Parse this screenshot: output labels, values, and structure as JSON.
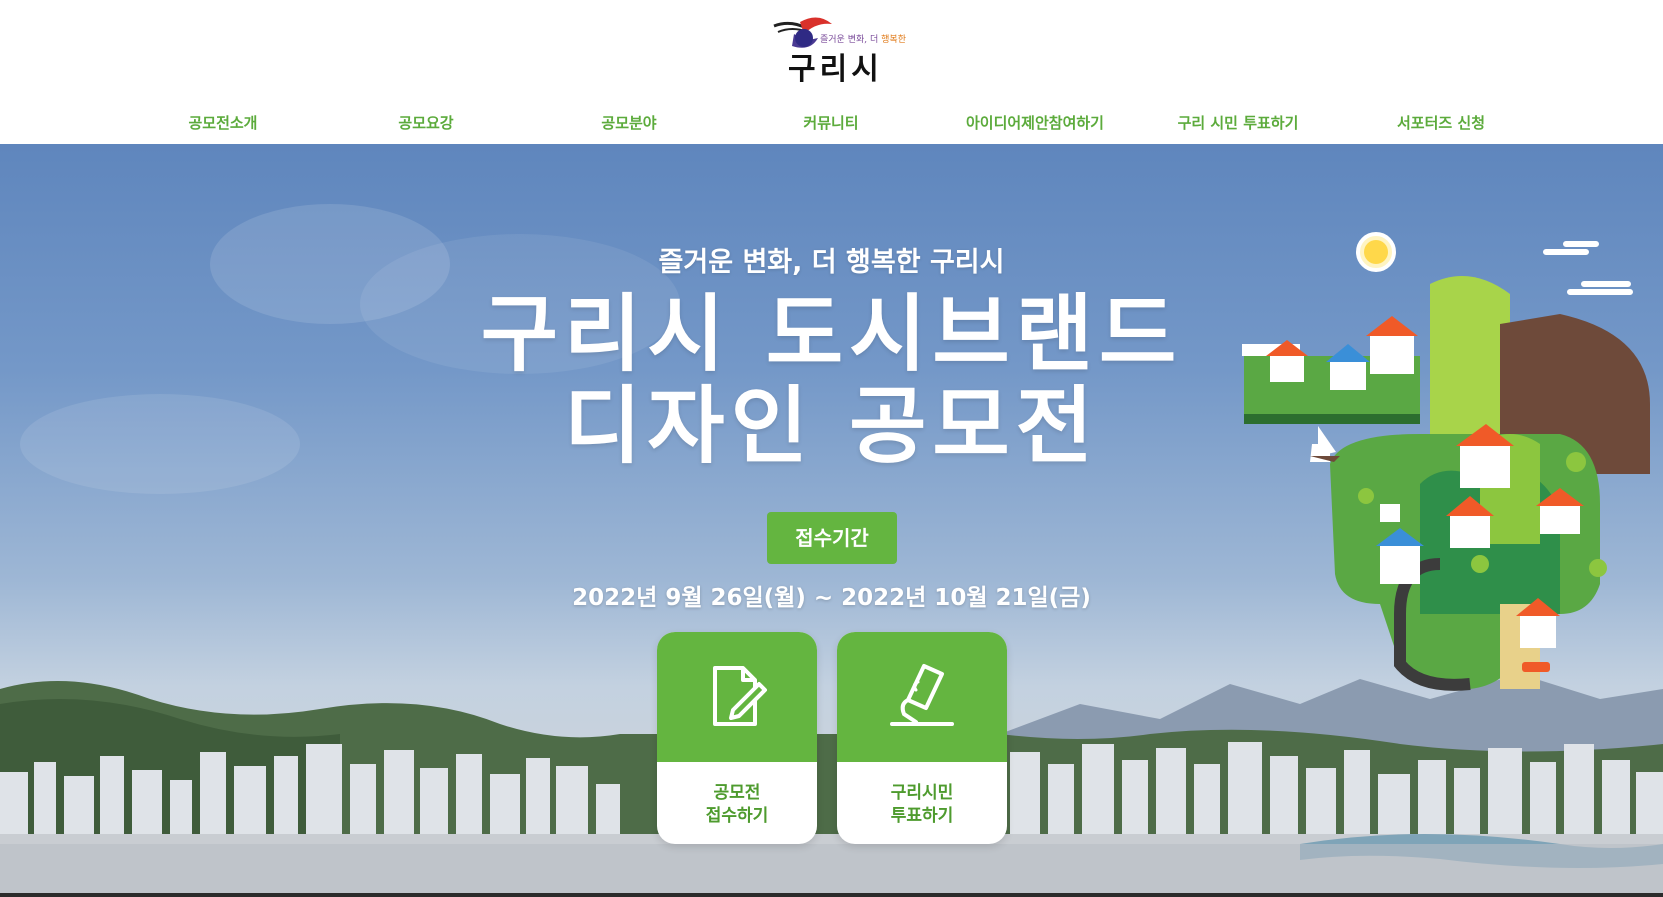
{
  "header": {
    "logo": {
      "tagline_parts": [
        "즐거운 ",
        "변화",
        ", 더 ",
        "행복한"
      ],
      "name": "구리시"
    },
    "nav": [
      {
        "label": "공모전소개"
      },
      {
        "label": "공모요강"
      },
      {
        "label": "공모분야"
      },
      {
        "label": "커뮤니티"
      },
      {
        "label": "아이디어제안참여하기"
      },
      {
        "label": "구리 시민 투표하기"
      },
      {
        "label": "서포터즈 신청"
      }
    ]
  },
  "hero": {
    "slogan": "즐거운 변화, 더 행복한 구리시",
    "title_line1": "구리시 도시브랜드",
    "title_line2": "디자인 공모전",
    "period_label": "접수기간",
    "period_dates": "2022년 9월 26일(월) ~ 2022년 10월 21일(금)",
    "cards": [
      {
        "line1": "공모전",
        "line2": "접수하기",
        "icon": "document-pen-icon"
      },
      {
        "line1": "구리시민",
        "line2": "투표하기",
        "icon": "ballot-vote-icon"
      }
    ]
  },
  "colors": {
    "accent_green": "#64b540",
    "nav_text_green": "#5cab3c",
    "sky_blue": "#5f86bd",
    "white": "#ffffff"
  }
}
